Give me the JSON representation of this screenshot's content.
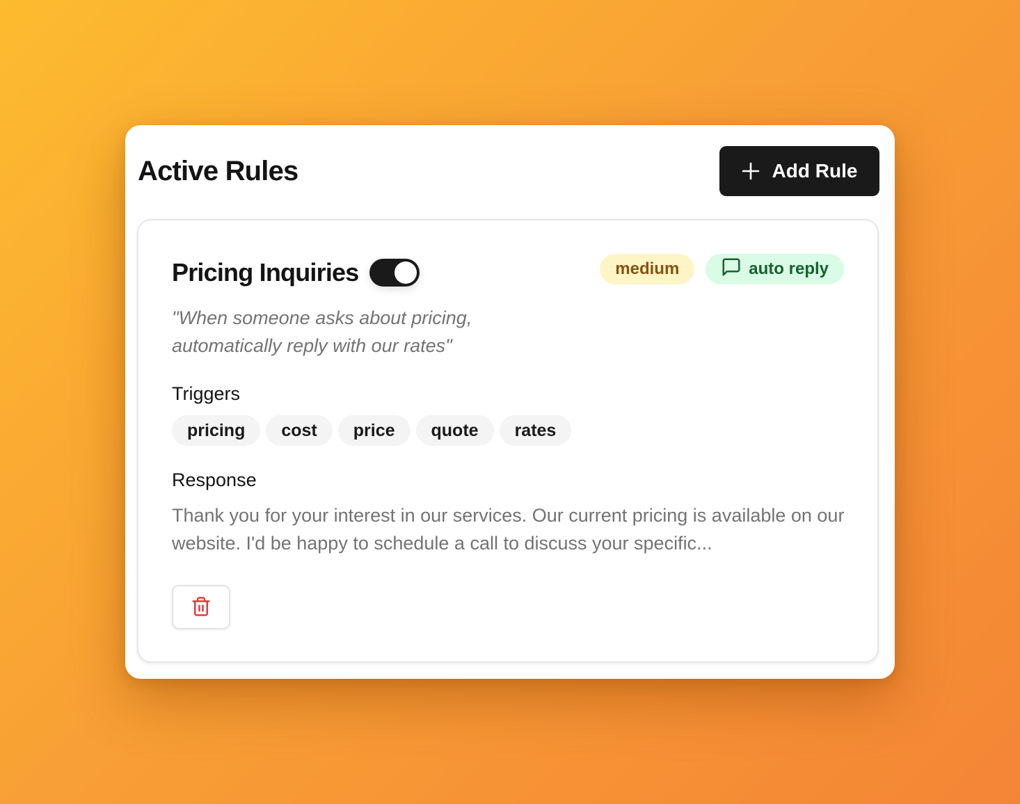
{
  "panel": {
    "title": "Active Rules",
    "add_button_label": "Add Rule"
  },
  "rule": {
    "name": "Pricing Inquiries",
    "enabled": true,
    "priority_badge": "medium",
    "action_badge": "auto reply",
    "description": "\"When someone asks about pricing, automatically reply with our rates\"",
    "triggers_label": "Triggers",
    "triggers": [
      "pricing",
      "cost",
      "price",
      "quote",
      "rates"
    ],
    "response_label": "Response",
    "response": "Thank you for your interest in our services. Our current pricing is available on our website. I'd be happy to schedule a call to discuss your specific..."
  },
  "icons": {
    "add": "plus-icon",
    "action": "message-square-icon",
    "delete": "trash-icon"
  },
  "colors": {
    "primary_button": "#1a1a1a",
    "priority_badge_bg": "#fdf5c6",
    "priority_badge_text": "#875310",
    "action_badge_bg": "#dafbe6",
    "action_badge_text": "#17612f",
    "delete_icon": "#e23b3b"
  }
}
